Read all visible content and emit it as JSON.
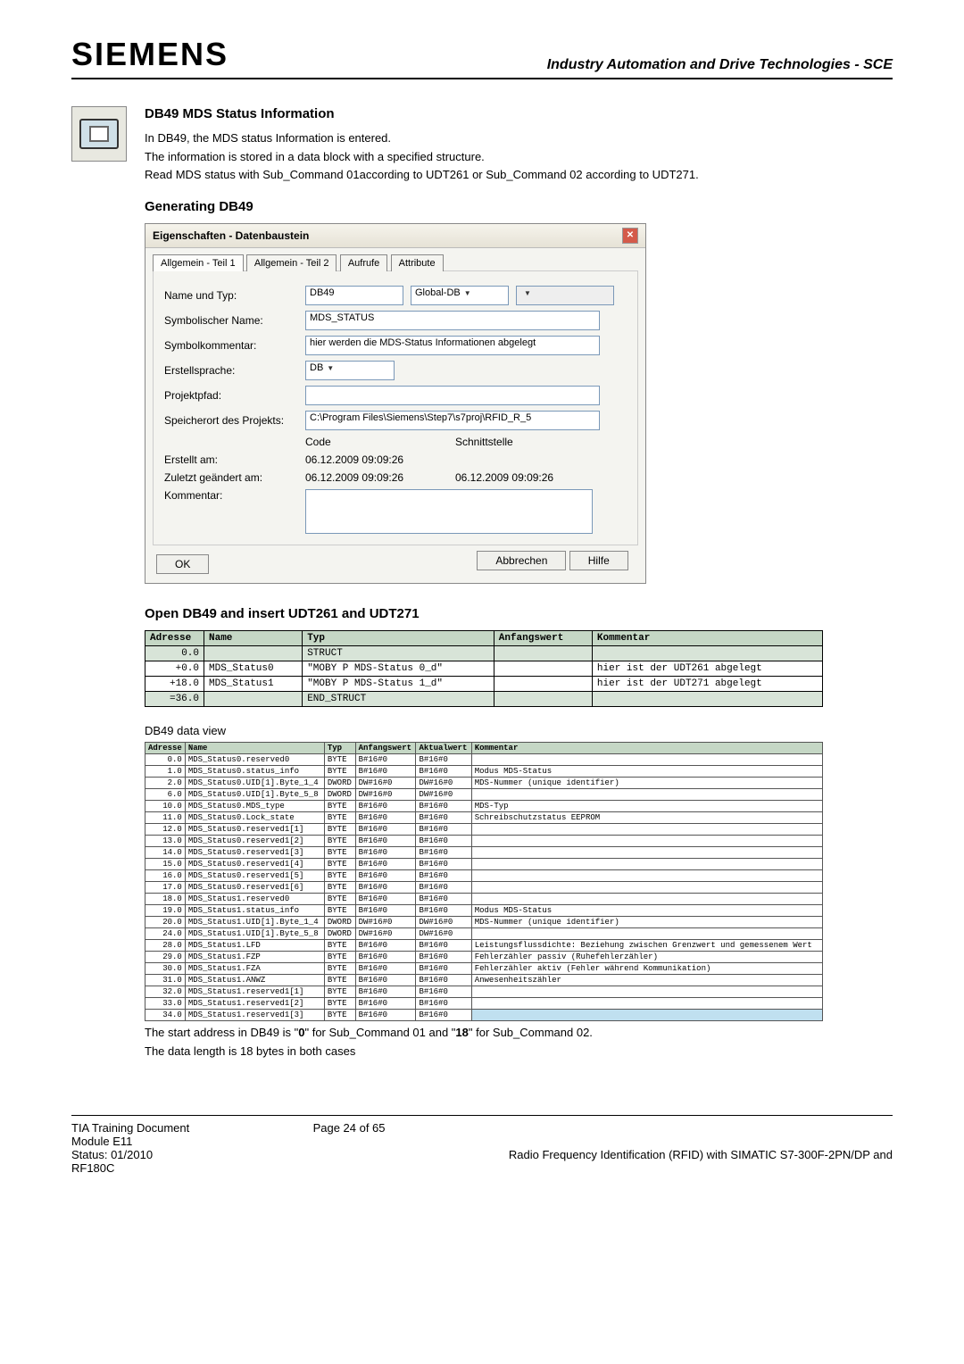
{
  "header": {
    "logo": "SIEMENS",
    "right": "Industry Automation and Drive Technologies - SCE"
  },
  "section1": {
    "title": "DB49 MDS Status Information",
    "p1": "In DB49, the MDS status Information is entered.",
    "p2": "The information is stored in a data block with a specified structure.",
    "p3": "Read MDS status with Sub_Command 01according to UDT261 or Sub_Command 02 according to UDT271."
  },
  "section2": {
    "title": "Generating DB49"
  },
  "dialog": {
    "title": "Eigenschaften - Datenbaustein",
    "tabs": [
      "Allgemein - Teil 1",
      "Allgemein - Teil 2",
      "Aufrufe",
      "Attribute"
    ],
    "labels": {
      "name_typ": "Name und Typ:",
      "sym_name": "Symbolischer Name:",
      "sym_kom": "Symbolkommentar:",
      "erst_spr": "Erstellsprache:",
      "projpfad": "Projektpfad:",
      "speicher": "Speicherort des Projekts:",
      "code": "Code",
      "schnitt": "Schnittstelle",
      "erstellt": "Erstellt am:",
      "zuletzt": "Zuletzt geändert am:",
      "kommentar": "Kommentar:"
    },
    "values": {
      "name": "DB49",
      "typ": "Global-DB",
      "sym_name": "MDS_STATUS",
      "sym_kom": "hier werden die MDS-Status Informationen abgelegt",
      "sprache": "DB",
      "speicher": "C:\\Program Files\\Siemens\\Step7\\s7proj\\RFID_R_5",
      "erstellt": "06.12.2009 09:09:26",
      "zuletzt_code": "06.12.2009 09:09:26",
      "zuletzt_schnitt": "06.12.2009 09:09:26"
    },
    "buttons": {
      "ok": "OK",
      "cancel": "Abbrechen",
      "help": "Hilfe"
    }
  },
  "section3": {
    "title": "Open DB49 and insert UDT261 and UDT271"
  },
  "struct_table": {
    "headers": [
      "Adresse",
      "Name",
      "Typ",
      "Anfangswert",
      "Kommentar"
    ],
    "rows": [
      {
        "addr": "0.0",
        "name": "",
        "typ": "STRUCT",
        "anf": "",
        "kom": ""
      },
      {
        "addr": "+0.0",
        "name": "MDS_Status0",
        "typ": "\"MOBY P MDS-Status 0_d\"",
        "anf": "",
        "kom": "hier ist der UDT261 abgelegt"
      },
      {
        "addr": "+18.0",
        "name": "MDS_Status1",
        "typ": "\"MOBY P MDS-Status 1_d\"",
        "anf": "",
        "kom": "hier ist der UDT271 abgelegt"
      },
      {
        "addr": "=36.0",
        "name": "",
        "typ": "END_STRUCT",
        "anf": "",
        "kom": ""
      }
    ]
  },
  "section4": {
    "title": "DB49 data view"
  },
  "dv_table": {
    "headers": [
      "Adresse",
      "Name",
      "Typ",
      "Anfangswert",
      "Aktualwert",
      "Kommentar"
    ],
    "rows": [
      {
        "a": "0.0",
        "n": "MDS_Status0.reserved0",
        "t": "BYTE",
        "an": "B#16#0",
        "ak": "B#16#0",
        "k": ""
      },
      {
        "a": "1.0",
        "n": "MDS_Status0.status_info",
        "t": "BYTE",
        "an": "B#16#0",
        "ak": "B#16#0",
        "k": "Modus MDS-Status"
      },
      {
        "a": "2.0",
        "n": "MDS_Status0.UID[1].Byte_1_4",
        "t": "DWORD",
        "an": "DW#16#0",
        "ak": "DW#16#0",
        "k": "MDS-Nummer (unique identifier)"
      },
      {
        "a": "6.0",
        "n": "MDS_Status0.UID[1].Byte_5_8",
        "t": "DWORD",
        "an": "DW#16#0",
        "ak": "DW#16#0",
        "k": ""
      },
      {
        "a": "10.0",
        "n": "MDS_Status0.MDS_type",
        "t": "BYTE",
        "an": "B#16#0",
        "ak": "B#16#0",
        "k": "MDS-Typ"
      },
      {
        "a": "11.0",
        "n": "MDS_Status0.Lock_state",
        "t": "BYTE",
        "an": "B#16#0",
        "ak": "B#16#0",
        "k": "Schreibschutzstatus EEPROM"
      },
      {
        "a": "12.0",
        "n": "MDS_Status0.reserved1[1]",
        "t": "BYTE",
        "an": "B#16#0",
        "ak": "B#16#0",
        "k": ""
      },
      {
        "a": "13.0",
        "n": "MDS_Status0.reserved1[2]",
        "t": "BYTE",
        "an": "B#16#0",
        "ak": "B#16#0",
        "k": ""
      },
      {
        "a": "14.0",
        "n": "MDS_Status0.reserved1[3]",
        "t": "BYTE",
        "an": "B#16#0",
        "ak": "B#16#0",
        "k": ""
      },
      {
        "a": "15.0",
        "n": "MDS_Status0.reserved1[4]",
        "t": "BYTE",
        "an": "B#16#0",
        "ak": "B#16#0",
        "k": ""
      },
      {
        "a": "16.0",
        "n": "MDS_Status0.reserved1[5]",
        "t": "BYTE",
        "an": "B#16#0",
        "ak": "B#16#0",
        "k": ""
      },
      {
        "a": "17.0",
        "n": "MDS_Status0.reserved1[6]",
        "t": "BYTE",
        "an": "B#16#0",
        "ak": "B#16#0",
        "k": ""
      },
      {
        "a": "18.0",
        "n": "MDS_Status1.reserved0",
        "t": "BYTE",
        "an": "B#16#0",
        "ak": "B#16#0",
        "k": ""
      },
      {
        "a": "19.0",
        "n": "MDS_Status1.status_info",
        "t": "BYTE",
        "an": "B#16#0",
        "ak": "B#16#0",
        "k": "Modus MDS-Status"
      },
      {
        "a": "20.0",
        "n": "MDS_Status1.UID[1].Byte_1_4",
        "t": "DWORD",
        "an": "DW#16#0",
        "ak": "DW#16#0",
        "k": "MDS-Nummer (unique identifier)"
      },
      {
        "a": "24.0",
        "n": "MDS_Status1.UID[1].Byte_5_8",
        "t": "DWORD",
        "an": "DW#16#0",
        "ak": "DW#16#0",
        "k": ""
      },
      {
        "a": "28.0",
        "n": "MDS_Status1.LFD",
        "t": "BYTE",
        "an": "B#16#0",
        "ak": "B#16#0",
        "k": "Leistungsflussdichte: Beziehung zwischen Grenzwert und gemessenem Wert"
      },
      {
        "a": "29.0",
        "n": "MDS_Status1.FZP",
        "t": "BYTE",
        "an": "B#16#0",
        "ak": "B#16#0",
        "k": "Fehlerzähler passiv (Ruhefehlerzähler)"
      },
      {
        "a": "30.0",
        "n": "MDS_Status1.FZA",
        "t": "BYTE",
        "an": "B#16#0",
        "ak": "B#16#0",
        "k": "Fehlerzähler aktiv (Fehler während Kommunikation)"
      },
      {
        "a": "31.0",
        "n": "MDS_Status1.ANWZ",
        "t": "BYTE",
        "an": "B#16#0",
        "ak": "B#16#0",
        "k": "Anwesenheitszähler"
      },
      {
        "a": "32.0",
        "n": "MDS_Status1.reserved1[1]",
        "t": "BYTE",
        "an": "B#16#0",
        "ak": "B#16#0",
        "k": ""
      },
      {
        "a": "33.0",
        "n": "MDS_Status1.reserved1[2]",
        "t": "BYTE",
        "an": "B#16#0",
        "ak": "B#16#0",
        "k": ""
      },
      {
        "a": "34.0",
        "n": "MDS_Status1.reserved1[3]",
        "t": "BYTE",
        "an": "B#16#0",
        "ak": "B#16#0",
        "k": ""
      }
    ]
  },
  "after_table": {
    "p1_a": "The start address in DB49 is \"",
    "p1_bold1": "0",
    "p1_b": "\" for Sub_Command 01 and \"",
    "p1_bold2": "18",
    "p1_c": "\" for Sub_Command 02.",
    "p2": "The data length is 18 bytes in both cases"
  },
  "footer": {
    "left1": "TIA Training Document",
    "left2": "Module E11",
    "left3": "Status: 01/2010",
    "left4": "RF180C",
    "center": "Page 24 of 65",
    "right": "Radio Frequency Identification (RFID) with SIMATIC S7-300F-2PN/DP and"
  }
}
